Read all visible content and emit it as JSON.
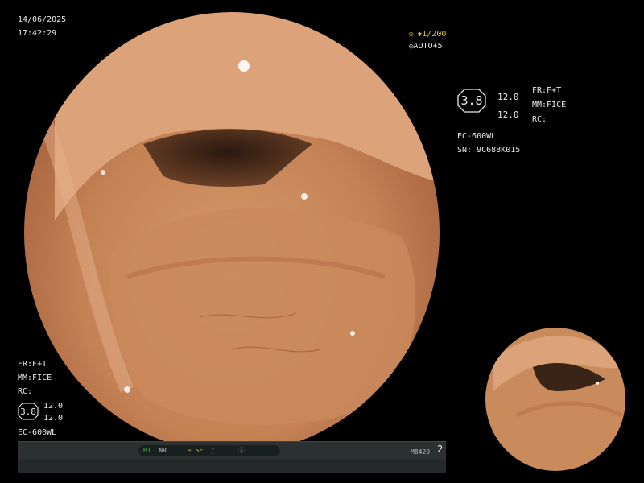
{
  "overlay": {
    "date": "14/06/2025",
    "time": "17:42:29",
    "shutter": "1/200",
    "exposure": "AUTO+5",
    "panel_right": {
      "enhance_level": "3.8",
      "val_top": "12.0",
      "val_bottom": "12.0",
      "model": "EC-600WL",
      "serial": "SN: 9C688K015",
      "fr": "FR:F+T",
      "mm": "MM:FICE",
      "rc": "RC:"
    },
    "panel_left": {
      "fr": "FR:F+T",
      "mm": "MM:FICE",
      "rc": "RC:",
      "enhance_level": "3.8",
      "val_top": "12.0",
      "val_bottom": "12.0",
      "model": "EC-600WL"
    }
  },
  "statusbar": {
    "ht": "HT",
    "nr": "NR",
    "se": "SE",
    "code": "M8420",
    "page": "2"
  },
  "colors": {
    "mucosa": "#c98a5c",
    "lumen": "#3a2418",
    "status_green": "#3fb04a",
    "status_yellow": "#d7c43a"
  },
  "icons": [
    "aperture-icon",
    "scissors-icon",
    "slash-icon",
    "circle-a-icon",
    "exposure-icon"
  ]
}
